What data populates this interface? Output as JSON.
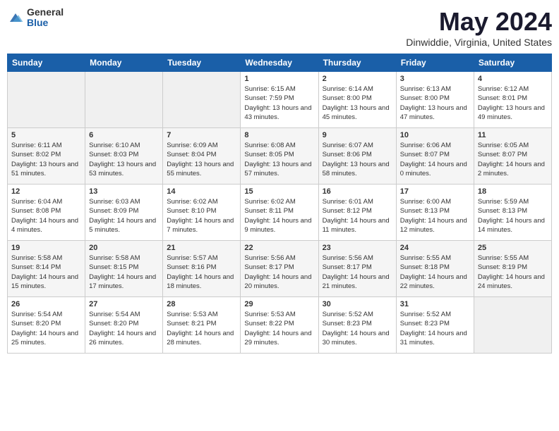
{
  "header": {
    "logo_general": "General",
    "logo_blue": "Blue",
    "month": "May 2024",
    "location": "Dinwiddie, Virginia, United States"
  },
  "weekdays": [
    "Sunday",
    "Monday",
    "Tuesday",
    "Wednesday",
    "Thursday",
    "Friday",
    "Saturday"
  ],
  "weeks": [
    [
      {
        "day": "",
        "info": ""
      },
      {
        "day": "",
        "info": ""
      },
      {
        "day": "",
        "info": ""
      },
      {
        "day": "1",
        "info": "Sunrise: 6:15 AM\nSunset: 7:59 PM\nDaylight: 13 hours\nand 43 minutes."
      },
      {
        "day": "2",
        "info": "Sunrise: 6:14 AM\nSunset: 8:00 PM\nDaylight: 13 hours\nand 45 minutes."
      },
      {
        "day": "3",
        "info": "Sunrise: 6:13 AM\nSunset: 8:00 PM\nDaylight: 13 hours\nand 47 minutes."
      },
      {
        "day": "4",
        "info": "Sunrise: 6:12 AM\nSunset: 8:01 PM\nDaylight: 13 hours\nand 49 minutes."
      }
    ],
    [
      {
        "day": "5",
        "info": "Sunrise: 6:11 AM\nSunset: 8:02 PM\nDaylight: 13 hours\nand 51 minutes."
      },
      {
        "day": "6",
        "info": "Sunrise: 6:10 AM\nSunset: 8:03 PM\nDaylight: 13 hours\nand 53 minutes."
      },
      {
        "day": "7",
        "info": "Sunrise: 6:09 AM\nSunset: 8:04 PM\nDaylight: 13 hours\nand 55 minutes."
      },
      {
        "day": "8",
        "info": "Sunrise: 6:08 AM\nSunset: 8:05 PM\nDaylight: 13 hours\nand 57 minutes."
      },
      {
        "day": "9",
        "info": "Sunrise: 6:07 AM\nSunset: 8:06 PM\nDaylight: 13 hours\nand 58 minutes."
      },
      {
        "day": "10",
        "info": "Sunrise: 6:06 AM\nSunset: 8:07 PM\nDaylight: 14 hours\nand 0 minutes."
      },
      {
        "day": "11",
        "info": "Sunrise: 6:05 AM\nSunset: 8:07 PM\nDaylight: 14 hours\nand 2 minutes."
      }
    ],
    [
      {
        "day": "12",
        "info": "Sunrise: 6:04 AM\nSunset: 8:08 PM\nDaylight: 14 hours\nand 4 minutes."
      },
      {
        "day": "13",
        "info": "Sunrise: 6:03 AM\nSunset: 8:09 PM\nDaylight: 14 hours\nand 5 minutes."
      },
      {
        "day": "14",
        "info": "Sunrise: 6:02 AM\nSunset: 8:10 PM\nDaylight: 14 hours\nand 7 minutes."
      },
      {
        "day": "15",
        "info": "Sunrise: 6:02 AM\nSunset: 8:11 PM\nDaylight: 14 hours\nand 9 minutes."
      },
      {
        "day": "16",
        "info": "Sunrise: 6:01 AM\nSunset: 8:12 PM\nDaylight: 14 hours\nand 11 minutes."
      },
      {
        "day": "17",
        "info": "Sunrise: 6:00 AM\nSunset: 8:13 PM\nDaylight: 14 hours\nand 12 minutes."
      },
      {
        "day": "18",
        "info": "Sunrise: 5:59 AM\nSunset: 8:13 PM\nDaylight: 14 hours\nand 14 minutes."
      }
    ],
    [
      {
        "day": "19",
        "info": "Sunrise: 5:58 AM\nSunset: 8:14 PM\nDaylight: 14 hours\nand 15 minutes."
      },
      {
        "day": "20",
        "info": "Sunrise: 5:58 AM\nSunset: 8:15 PM\nDaylight: 14 hours\nand 17 minutes."
      },
      {
        "day": "21",
        "info": "Sunrise: 5:57 AM\nSunset: 8:16 PM\nDaylight: 14 hours\nand 18 minutes."
      },
      {
        "day": "22",
        "info": "Sunrise: 5:56 AM\nSunset: 8:17 PM\nDaylight: 14 hours\nand 20 minutes."
      },
      {
        "day": "23",
        "info": "Sunrise: 5:56 AM\nSunset: 8:17 PM\nDaylight: 14 hours\nand 21 minutes."
      },
      {
        "day": "24",
        "info": "Sunrise: 5:55 AM\nSunset: 8:18 PM\nDaylight: 14 hours\nand 22 minutes."
      },
      {
        "day": "25",
        "info": "Sunrise: 5:55 AM\nSunset: 8:19 PM\nDaylight: 14 hours\nand 24 minutes."
      }
    ],
    [
      {
        "day": "26",
        "info": "Sunrise: 5:54 AM\nSunset: 8:20 PM\nDaylight: 14 hours\nand 25 minutes."
      },
      {
        "day": "27",
        "info": "Sunrise: 5:54 AM\nSunset: 8:20 PM\nDaylight: 14 hours\nand 26 minutes."
      },
      {
        "day": "28",
        "info": "Sunrise: 5:53 AM\nSunset: 8:21 PM\nDaylight: 14 hours\nand 28 minutes."
      },
      {
        "day": "29",
        "info": "Sunrise: 5:53 AM\nSunset: 8:22 PM\nDaylight: 14 hours\nand 29 minutes."
      },
      {
        "day": "30",
        "info": "Sunrise: 5:52 AM\nSunset: 8:23 PM\nDaylight: 14 hours\nand 30 minutes."
      },
      {
        "day": "31",
        "info": "Sunrise: 5:52 AM\nSunset: 8:23 PM\nDaylight: 14 hours\nand 31 minutes."
      },
      {
        "day": "",
        "info": ""
      }
    ]
  ]
}
